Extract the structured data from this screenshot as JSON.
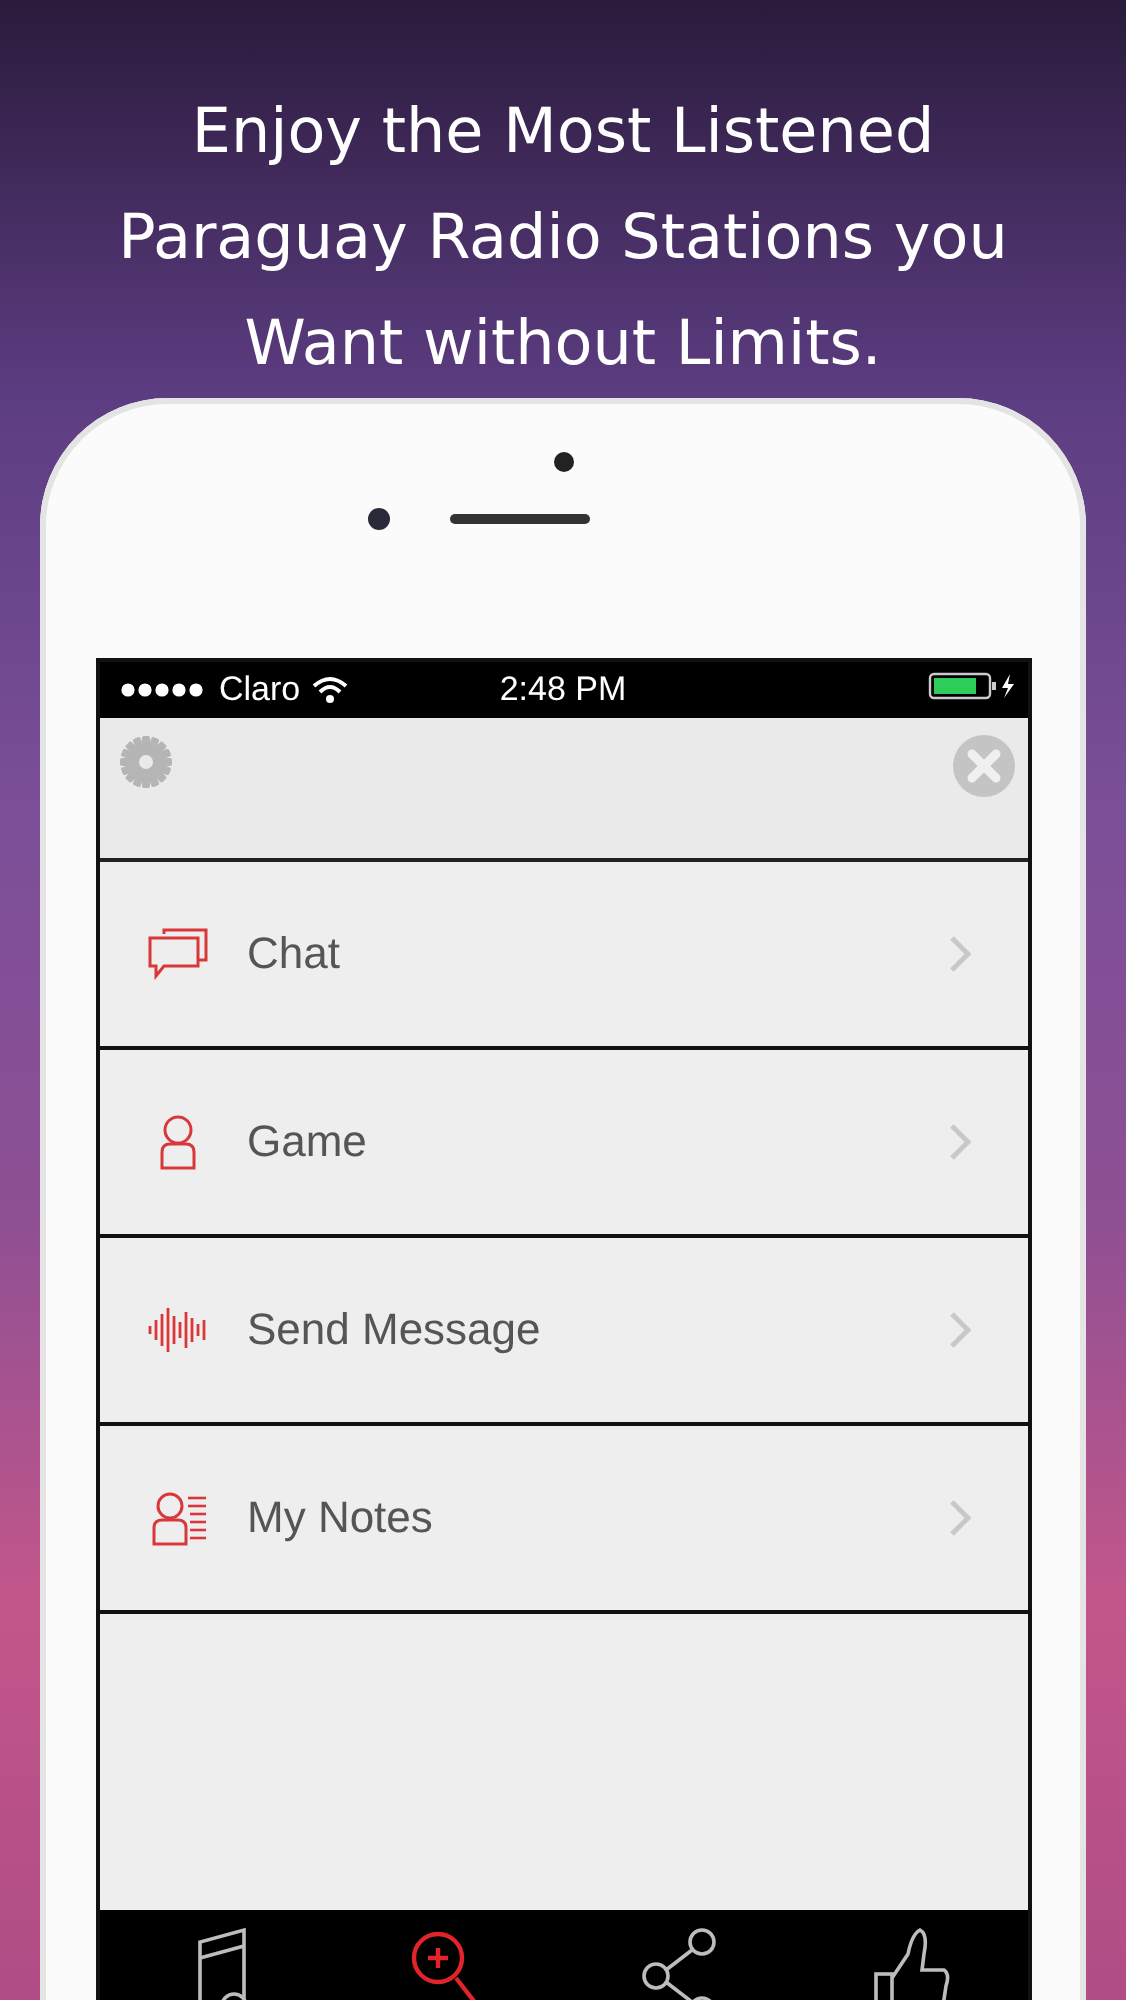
{
  "headline": "Enjoy the Most Listened Paraguay Radio Stations you Want without Limits.",
  "status_bar": {
    "carrier": "Claro",
    "time": "2:48 PM"
  },
  "menu": [
    {
      "label": "Chat"
    },
    {
      "label": "Game"
    },
    {
      "label": "Send Message"
    },
    {
      "label": "My Notes"
    }
  ],
  "tabs": [
    {
      "selected": false
    },
    {
      "selected": true
    },
    {
      "selected": false
    },
    {
      "selected": false
    }
  ]
}
